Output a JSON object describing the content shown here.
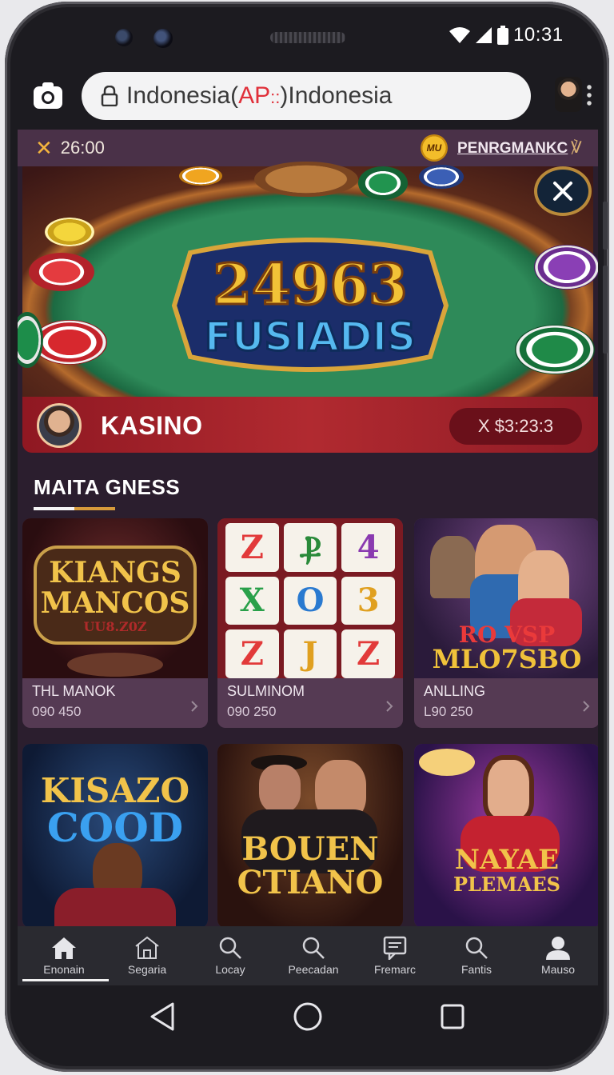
{
  "status": {
    "time": "10:31"
  },
  "browser": {
    "url_prefix": "Indonesia(",
    "url_red": "AP",
    "url_red2": "::",
    "url_suffix": ")Indonesia"
  },
  "topbar": {
    "timer": "26:00",
    "partner_logo": "MU",
    "partner_label": "PENRGMANKC",
    "partner_mark": "℣"
  },
  "hero": {
    "title_line1": "24963",
    "title_line2": "FUSIADIS"
  },
  "kasino": {
    "label": "KASINO",
    "timer": "X $3:23:3"
  },
  "section": {
    "title": "MAITA GNESS"
  },
  "games": [
    {
      "art_line1": "KIANGS",
      "art_line2": "MANCOS",
      "art_line3": "UU8.Z0Z",
      "name": "THL MANOK",
      "meta": "090 450"
    },
    {
      "art_line1": "",
      "art_line2": "",
      "art_line3": "",
      "name": "SULMINOM",
      "meta": "090 250"
    },
    {
      "art_line1": "RO VSP",
      "art_line2": "MLO7SBO",
      "art_line3": "",
      "name": "ANLLING",
      "meta": "L90 250"
    },
    {
      "art_line1": "KISAZO",
      "art_line2": "COOD",
      "art_line3": "",
      "name": "",
      "meta": ""
    },
    {
      "art_line1": "BOUEN",
      "art_line2": "CTIANO",
      "art_line3": "",
      "name": "",
      "meta": ""
    },
    {
      "art_line1": "NAYAE",
      "art_line2": "PLEMAES",
      "art_line3": "",
      "name": "",
      "meta": ""
    }
  ],
  "slot_symbols": [
    "Z",
    "Ⳁ",
    "4",
    "X",
    "O",
    "3",
    "Z",
    "J",
    "Z"
  ],
  "tabs": [
    {
      "label": "Enonain",
      "icon": "home-icon"
    },
    {
      "label": "Segaria",
      "icon": "store-icon"
    },
    {
      "label": "Locay",
      "icon": "search-icon"
    },
    {
      "label": "Peecadan",
      "icon": "search-icon"
    },
    {
      "label": "Fremarc",
      "icon": "chat-icon"
    },
    {
      "label": "Fantis",
      "icon": "search-icon"
    },
    {
      "label": "Mauso",
      "icon": "profile-icon"
    }
  ]
}
